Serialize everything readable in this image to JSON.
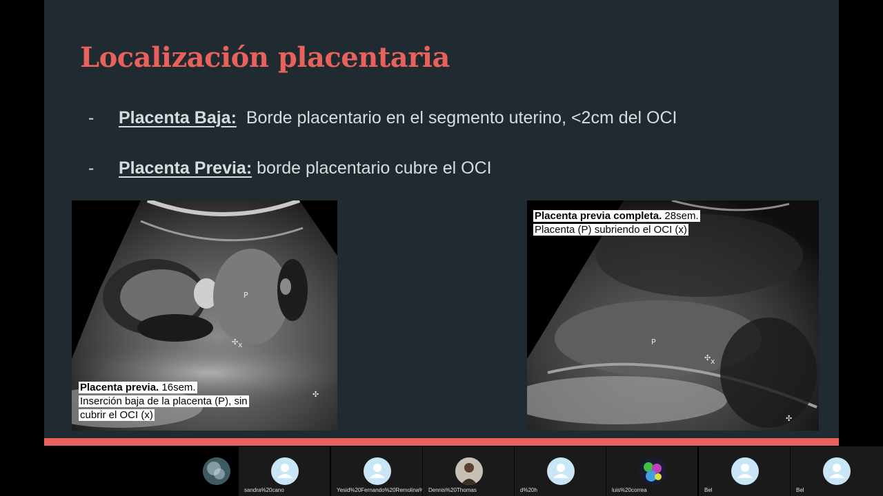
{
  "slide": {
    "title": "Localización placentaria",
    "bullets": [
      {
        "dash": "-",
        "term": "Placenta Baja:",
        "definition": "Borde placentario en el segmento uterino, <2cm del OCI"
      },
      {
        "dash": "-",
        "term": "Placenta Previa:",
        "definition": "borde placentario cubre el OCI"
      }
    ],
    "images": [
      {
        "caption_bold": "Placenta previa.",
        "caption_rest": "16sem.",
        "caption_line2": "Inserción baja de la placenta (P), sin",
        "caption_line3": "cubrir el OCI (x)",
        "marker_p": "P",
        "marker_x": "x"
      },
      {
        "caption_bold": "Placenta previa completa.",
        "caption_rest": "28sem.",
        "caption_line2": "Placenta (P) subriendo el OCI (x)",
        "marker_p": "P",
        "marker_x": "x"
      }
    ]
  },
  "participants": [
    {
      "name": "",
      "avatar": "image-avatar-globe"
    },
    {
      "name": "sandra%20cano",
      "avatar": "person-icon"
    },
    {
      "name": "Yesid%20Fernando%20Remolina%2…",
      "avatar": "person-icon"
    },
    {
      "name": "Dennis%20Thomas",
      "avatar": "photo-avatar"
    },
    {
      "name": "d%20h",
      "avatar": "person-icon"
    },
    {
      "name": "luis%20correa",
      "avatar": "image-avatar-colorful"
    },
    {
      "name": "Bel",
      "avatar": "person-icon"
    },
    {
      "name": "Bel",
      "avatar": "person-icon"
    }
  ],
  "colors": {
    "slide_bg": "#1f2b30",
    "title": "#e8615c",
    "accent_bar": "#e8615c",
    "text": "#d8dcdd",
    "avatar_bg": "#c9e6f7"
  }
}
